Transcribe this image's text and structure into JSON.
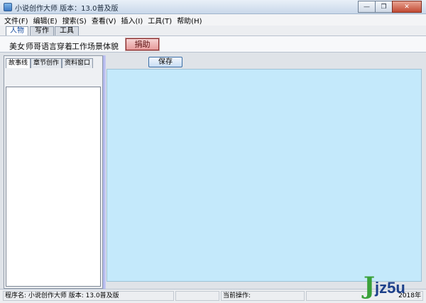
{
  "window": {
    "title": "小说创作大师 版本：13.0普及版",
    "minimize": "—",
    "restore": "❐",
    "close": "✕"
  },
  "menu": [
    "文件(F)",
    "编辑(E)",
    "搜索(S)",
    "查看(V)",
    "插入(I)",
    "工具(T)",
    "帮助(H)"
  ],
  "tabs": [
    {
      "label": "人物",
      "active": true
    },
    {
      "label": "写作",
      "active": false
    },
    {
      "label": "工具",
      "active": false
    }
  ],
  "toolbar": {
    "words": [
      "美女",
      "师哥",
      "语言",
      "穿着",
      "工作",
      "场景",
      "体貌"
    ],
    "donate_label": "捐助"
  },
  "left_panel": {
    "tabs": [
      {
        "label": "故事线",
        "active": true
      },
      {
        "label": "章节创作",
        "active": false
      },
      {
        "label": "资料窗口",
        "active": false
      }
    ]
  },
  "editor": {
    "save_label": "保存",
    "background": "#c4e9fb"
  },
  "statusbar": {
    "program": "程序名: 小说创作大师 版本: 13.0普及版",
    "operation": "当前操作:",
    "year": "2018年"
  },
  "watermark": {
    "letter_j": "J",
    "text": "jz5u"
  }
}
